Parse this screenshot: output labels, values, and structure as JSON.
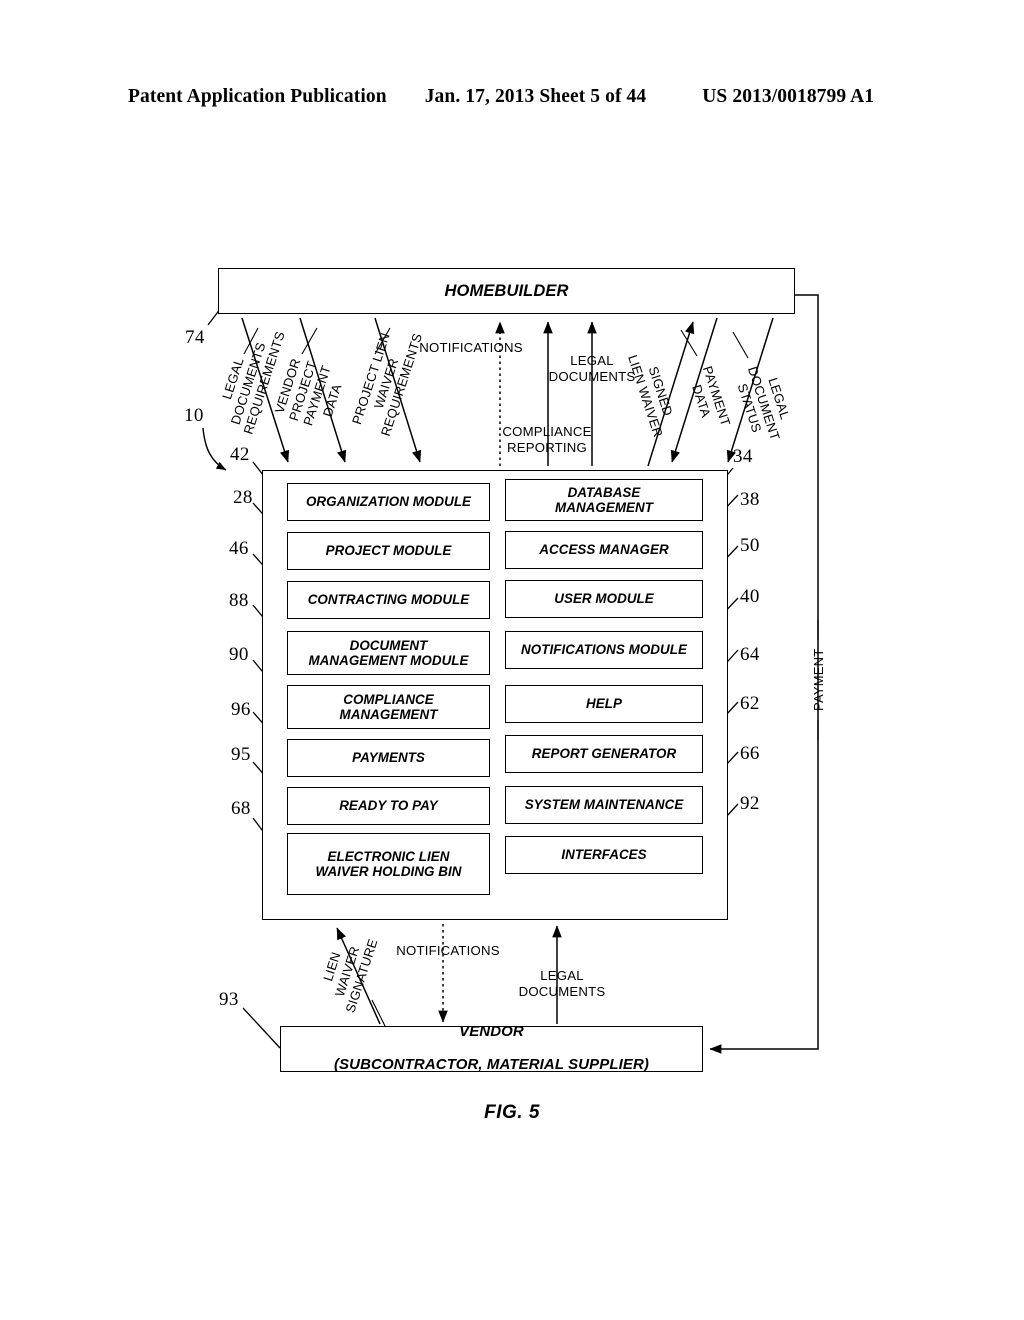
{
  "header": {
    "publication": "Patent Application Publication",
    "date_sheet": "Jan. 17, 2013  Sheet 5 of 44",
    "pub_number": "US 2013/0018799 A1"
  },
  "figure": {
    "caption": "FIG. 5"
  },
  "nodes": {
    "homebuilder": "HOMEBUILDER",
    "vendor_line1": "VENDOR",
    "vendor_line2": "(SUBCONTRACTOR, MATERIAL SUPPLIER)"
  },
  "modules_left": [
    {
      "label": "ORGANIZATION MODULE",
      "ref": "28"
    },
    {
      "label": "PROJECT MODULE",
      "ref": "46"
    },
    {
      "label": "CONTRACTING MODULE",
      "ref": "88"
    },
    {
      "label": "DOCUMENT\nMANAGEMENT MODULE",
      "ref": "90"
    },
    {
      "label": "COMPLIANCE\nMANAGEMENT",
      "ref": "96"
    },
    {
      "label": "PAYMENTS",
      "ref": "95"
    },
    {
      "label": "READY TO PAY",
      "ref": "68"
    },
    {
      "label": "ELECTRONIC LIEN\nWAIVER HOLDING BIN",
      "ref": ""
    }
  ],
  "modules_right": [
    {
      "label": "DATABASE\nMANAGEMENT",
      "ref": "38"
    },
    {
      "label": "ACCESS MANAGER",
      "ref": "50"
    },
    {
      "label": "USER MODULE",
      "ref": "40"
    },
    {
      "label": "NOTIFICATIONS MODULE",
      "ref": "64"
    },
    {
      "label": "HELP",
      "ref": "62"
    },
    {
      "label": "REPORT GENERATOR",
      "ref": "66"
    },
    {
      "label": "SYSTEM MAINTENANCE",
      "ref": "92"
    },
    {
      "label": "INTERFACES",
      "ref": ""
    }
  ],
  "flow_labels_top": [
    {
      "name": "legal-documents-requirements",
      "text": "LEGAL\nDOCUMENTS\nREQUIREMENTS",
      "rotated": true
    },
    {
      "name": "vendor-project-payment-data",
      "text": "VENDOR\nPROJECT\nPAYMENT DATA",
      "rotated": true
    },
    {
      "name": "project-lien-waiver-requirements",
      "text": "PROJECT LIEN\nWAIVER\nREQUIREMENTS",
      "rotated": true
    },
    {
      "name": "notifications-top",
      "text": "NOTIFICATIONS",
      "rotated": false
    },
    {
      "name": "compliance-reporting",
      "text": "COMPLIANCE\nREPORTING",
      "rotated": false
    },
    {
      "name": "legal-documents-top",
      "text": "LEGAL\nDOCUMENTS",
      "rotated": false
    },
    {
      "name": "signed-lien-waiver",
      "text": "SIGNED\nLIEN WAIVER",
      "rotated": true
    },
    {
      "name": "payment-data",
      "text": "PAYMENT DATA",
      "rotated": true
    },
    {
      "name": "legal-document-status",
      "text": "LEGAL\nDOCUMENT\nSTATUS",
      "rotated": true
    }
  ],
  "flow_labels_bottom": [
    {
      "name": "lien-waiver-signature",
      "text": "LIEN\nWAIVER\nSIGNATURE",
      "rotated": true
    },
    {
      "name": "notifications-bottom",
      "text": "NOTIFICATIONS",
      "rotated": false
    },
    {
      "name": "legal-documents-bottom",
      "text": "LEGAL\nDOCUMENTS",
      "rotated": false
    }
  ],
  "flow_labels_right": [
    {
      "name": "payment",
      "text": "PAYMENT",
      "rotated": true
    }
  ],
  "ref_numbers": {
    "system_overall": "10",
    "homebuilder": "74",
    "system_box_left": "42",
    "system_box_right": "34",
    "vendor": "93"
  },
  "colors": {
    "ink": "#000000",
    "paper": "#ffffff"
  }
}
